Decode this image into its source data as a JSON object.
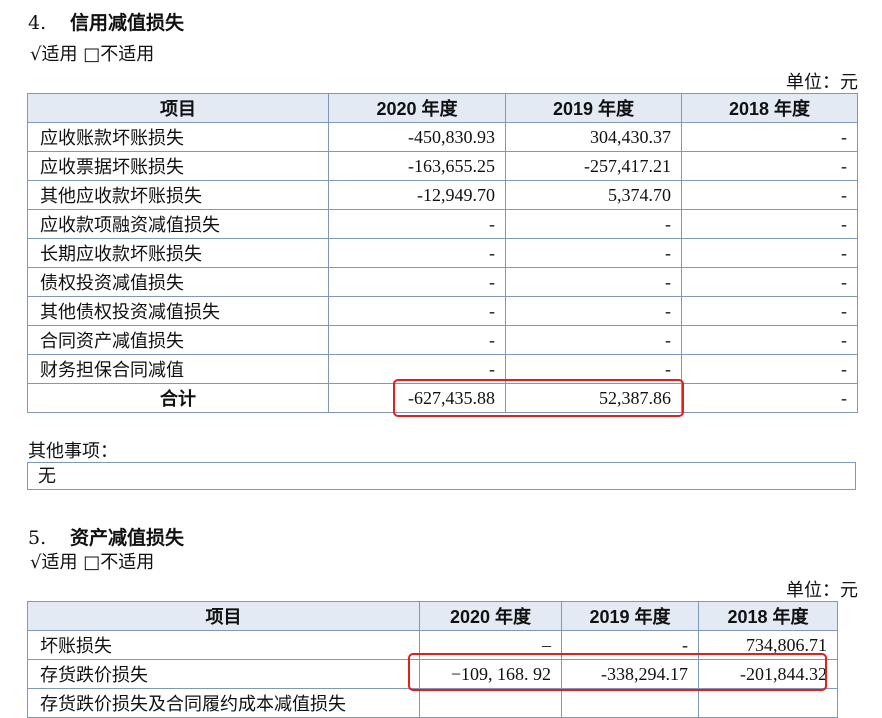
{
  "section4": {
    "number": "4.",
    "title": "信用减值损失",
    "applicability": "√适用 □不适用",
    "unit": "单位：元",
    "columns": [
      "项目",
      "2020 年度",
      "2019 年度",
      "2018 年度"
    ],
    "rows": [
      {
        "item": "应收账款坏账损失",
        "y2020": "-450,830.93",
        "y2019": "304,430.37",
        "y2018": "-"
      },
      {
        "item": "应收票据坏账损失",
        "y2020": "-163,655.25",
        "y2019": "-257,417.21",
        "y2018": "-"
      },
      {
        "item": "其他应收款坏账损失",
        "y2020": "-12,949.70",
        "y2019": "5,374.70",
        "y2018": "-"
      },
      {
        "item": "应收款项融资减值损失",
        "y2020": "-",
        "y2019": "-",
        "y2018": "-"
      },
      {
        "item": "长期应收款坏账损失",
        "y2020": "-",
        "y2019": "-",
        "y2018": "-"
      },
      {
        "item": "债权投资减值损失",
        "y2020": "-",
        "y2019": "-",
        "y2018": "-"
      },
      {
        "item": "其他债权投资减值损失",
        "y2020": "-",
        "y2019": "-",
        "y2018": "-"
      },
      {
        "item": "合同资产减值损失",
        "y2020": "-",
        "y2019": "-",
        "y2018": "-"
      },
      {
        "item": "财务担保合同减值",
        "y2020": "-",
        "y2019": "-",
        "y2018": "-"
      }
    ],
    "total": {
      "item": "合计",
      "y2020": "-627,435.88",
      "y2019": "52,387.86",
      "y2018": "-"
    }
  },
  "other_matters": {
    "label": "其他事项：",
    "value": "无"
  },
  "section5": {
    "number": "5.",
    "title": "资产减值损失",
    "applicability": "√适用 □不适用",
    "unit": "单位：元",
    "columns": [
      "项目",
      "2020 年度",
      "2019 年度",
      "2018 年度"
    ],
    "rows": [
      {
        "item": "坏账损失",
        "y2020": "–",
        "y2019": "-",
        "y2018": "734,806.71"
      },
      {
        "item": "存货跌价损失",
        "y2020": "−109, 168. 92",
        "y2019": "-338,294.17",
        "y2018": "-201,844.32"
      },
      {
        "item": "存货跌价损失及合同履约成本减值损失",
        "y2020": "",
        "y2019": "",
        "y2018": ""
      }
    ]
  },
  "highlight_color": "#e0201c",
  "border_color": "#7f97b8",
  "header_bg": "#e3eaf4"
}
